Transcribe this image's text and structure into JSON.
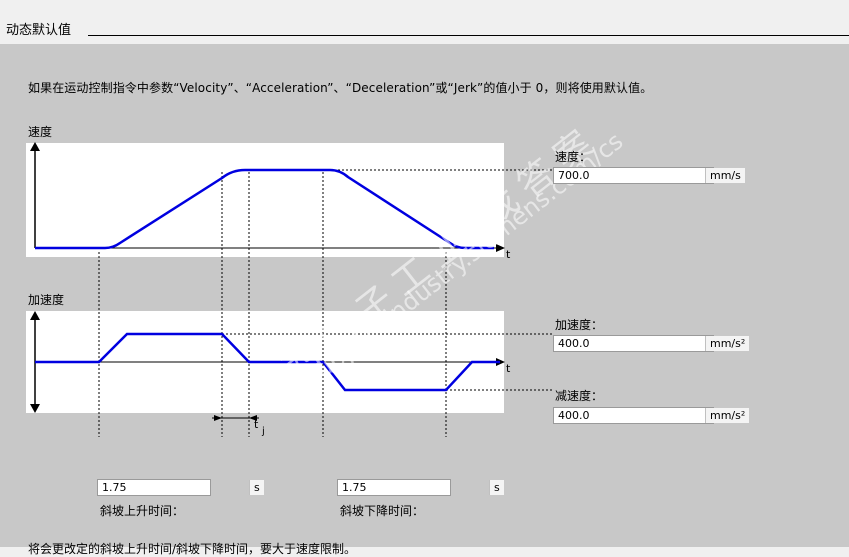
{
  "header": {
    "title": "动态默认值"
  },
  "description": "如果在运动控制指令中参数“Velocity”、“Acceleration”、“Deceleration”或“Jerk”的值小于 0，则将使用默认值。",
  "velocity_chart": {
    "title": "速度",
    "axis_label": "t"
  },
  "accel_chart": {
    "title": "加速度",
    "axis_label": "t",
    "jerk_label": "t",
    "jerk_sub": "j"
  },
  "fields": {
    "velocity": {
      "label": "速度：",
      "value": "700.0",
      "unit": "mm/s"
    },
    "acceleration": {
      "label": "加速度：",
      "value": "400.0",
      "unit": "mm/s²"
    },
    "deceleration": {
      "label": "减速度：",
      "value": "400.0",
      "unit": "mm/s²"
    },
    "ramp_up": {
      "label": "斜坡上升时间：",
      "value": "1.75",
      "unit": "s"
    },
    "ramp_down": {
      "label": "斜坡下降时间：",
      "value": "1.75",
      "unit": "s"
    }
  },
  "bottom_text": "将会更改定的斜坡上升时间/斜坡下降时间，要大于速度限制。",
  "watermark": {
    "cn": "西门子工业 找答案",
    "url": "support.industry.siemens.com/cs"
  },
  "colors": {
    "curve": "#0000e0",
    "panel": "#c8c8c8",
    "plot": "#ffffff"
  }
}
